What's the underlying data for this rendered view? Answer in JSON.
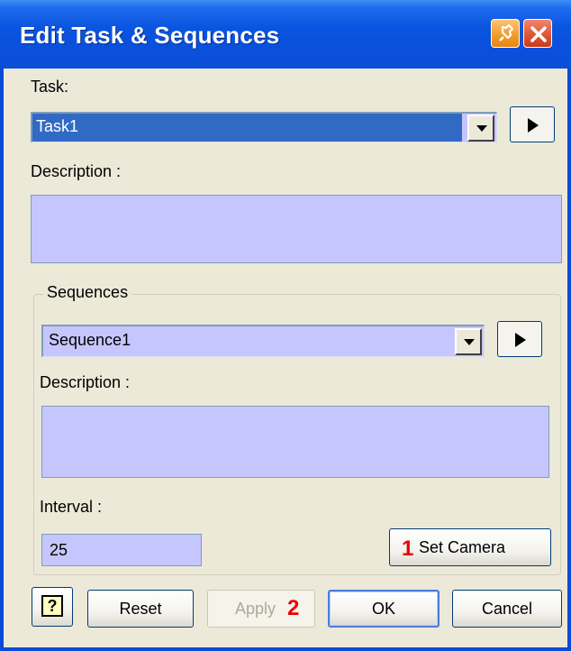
{
  "window": {
    "title": "Edit Task & Sequences"
  },
  "task": {
    "label": "Task:",
    "selected": "Task1",
    "description_label": "Description :",
    "description_value": ""
  },
  "sequences": {
    "group_label": "Sequences",
    "selected": "Sequence1",
    "description_label": "Description :",
    "description_value": "",
    "interval_label": "Interval :",
    "interval_value": "25",
    "set_camera_label": "Set Camera",
    "set_camera_marker": "1"
  },
  "footer": {
    "help_glyph": "?",
    "reset_label": "Reset",
    "apply_label": "Apply",
    "apply_marker": "2",
    "ok_label": "OK",
    "cancel_label": "Cancel"
  },
  "colors": {
    "field_bg": "#c6c6ff",
    "titlebar": "#0a55e0",
    "marker": "#ee0000"
  }
}
